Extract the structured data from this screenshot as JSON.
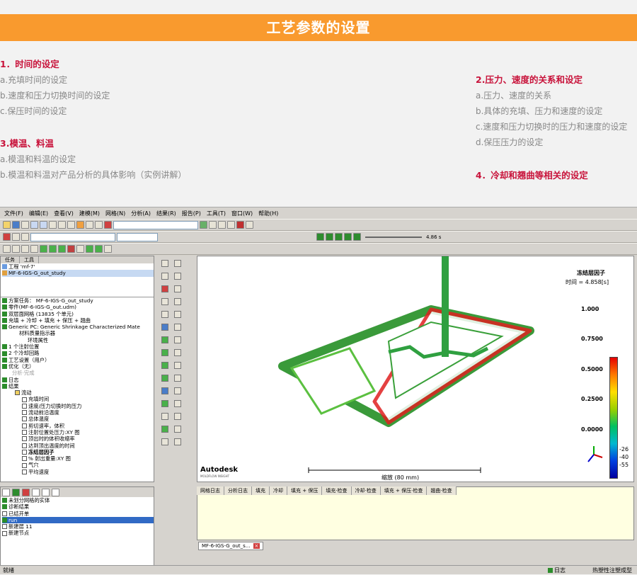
{
  "header": {
    "title": "工艺参数的设置"
  },
  "sections": {
    "s1": {
      "heading": "1．时间的设定",
      "items": [
        "a.充填时间的设定",
        "b.速度和压力切换时间的设定",
        "c.保压时间的设定"
      ]
    },
    "s3": {
      "heading": "3.模温、料温",
      "items": [
        "a.模温和料温的设定",
        "b.模温和料温对产品分析的具体影响（实例讲解）"
      ]
    },
    "s2": {
      "heading": "2.压力、速度的关系和设定",
      "items": [
        "a.压力、速度的关系",
        "b.具体的充填、压力和速度的设定",
        "c.速度和压力切换时的压力和速度的设定",
        "d.保压压力的设定"
      ]
    },
    "s4": {
      "heading": "4．冷却和翘曲等相关的设定"
    }
  },
  "app": {
    "menu": [
      "文件(F)",
      "编辑(E)",
      "查看(V)",
      "建模(M)",
      "网格(N)",
      "分析(A)",
      "结果(R)",
      "报告(P)",
      "工具(T)",
      "窗口(W)",
      "帮助(H)"
    ],
    "time_readout": "4.86 s",
    "tabs": [
      "任务",
      "工具"
    ],
    "project": "工程 'mf-7'",
    "study": "MF-6-IGS-G_out_study",
    "tree": [
      "方案任务： MF-6-IGS-G_out_study",
      "零件(MF-6-IGS-G_out.udm)",
      "双层面网格 (13835 个单元)",
      "充填 + 冷却 + 填充 + 保压 + 翘曲",
      "Generic PC: Generic Shrinkage Characterized Mate",
      "材料质量指示器",
      "环境属性",
      "1 个注射位置",
      "2 个冷却回路",
      "工艺设置（用户）",
      "优化（无）",
      "分析·完成",
      "日志",
      "结果",
      "流动",
      "充填时间",
      "速度/压力切换时的压力",
      "流动前沿温度",
      "总体温度",
      "剪切速率，体积",
      "注射位置处压力:XY 图",
      "顶出时的体积收缩率",
      "达到顶出温度的时间",
      "冻结层因子",
      "% 射出重量:XY 图",
      "气穴",
      "平均速度"
    ],
    "viewport": {
      "title": "冻结层因子",
      "time": "时间 = 4.858[s]",
      "scale_ticks": [
        "1.000",
        "0.7500",
        "0.5000",
        "0.2500",
        "0.0000"
      ],
      "brand": "Autodesk",
      "brand_sub": "MOLDFLOW INSIGHT",
      "scale_label": "缩放 (80 mm)",
      "axis_values": [
        "-26",
        "-40",
        "-55"
      ]
    },
    "layers": [
      "未划分网格的实体",
      "诊断结果",
      "已结开单",
      "run",
      "新建层 11",
      "新建节点"
    ],
    "log_tabs": [
      "网格日志",
      "分析日志",
      "填充",
      "冷却",
      "填充 + 保压",
      "填充·检查",
      "冷却·检查",
      "填充 + 保压·检查",
      "翘曲·检查"
    ],
    "doc_tab": "MF-6-IGS-G_out_s...",
    "status_left": "就绪",
    "status_log": "日志",
    "status_right": "热塑性注塑成型"
  }
}
